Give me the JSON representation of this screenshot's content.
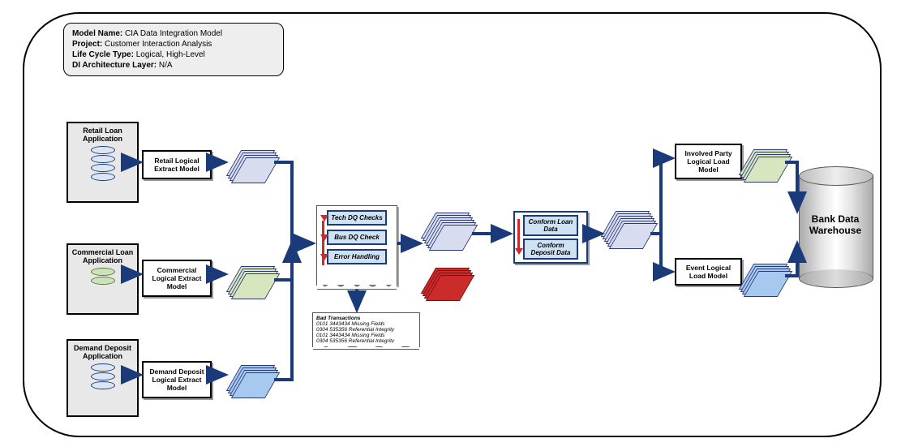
{
  "legend": {
    "model_name_label": "Model Name:",
    "model_name": "CIA Data Integration Model",
    "project_label": "Project:",
    "project": "Customer Interaction Analysis",
    "lifecycle_label": "Life Cycle Type:",
    "lifecycle": "Logical, High-Level",
    "arch_label": "DI Architecture Layer:",
    "arch": "N/A"
  },
  "sources": {
    "retail": {
      "app": "Retail Loan Application",
      "extract": "Retail Logical Extract Model"
    },
    "commercial": {
      "app": "Commercial Loan Application",
      "extract": "Commercial Logical Extract Model"
    },
    "deposit": {
      "app": "Demand Deposit Application",
      "extract": "Demand Deposit Logical Extract Model"
    }
  },
  "dq": {
    "step1": "Tech DQ Checks",
    "step2": "Bus DQ Check",
    "step3": "Error Handling"
  },
  "bad_note": {
    "title": "Bad Transactions",
    "l1": "0101 3443434 Missing Fields",
    "l2": "0304 535356 Referential Integrity",
    "l3": "0101 3443434 Missing Fields",
    "l4": "0304 535356 Referential Integrity"
  },
  "conform": {
    "step1": "Conform Loan Data",
    "step2": "Conform Deposit Data"
  },
  "loads": {
    "party": "Involved Party Logical Load Model",
    "event": "Event Logical Load Model"
  },
  "warehouse": "Bank Data Warehouse"
}
